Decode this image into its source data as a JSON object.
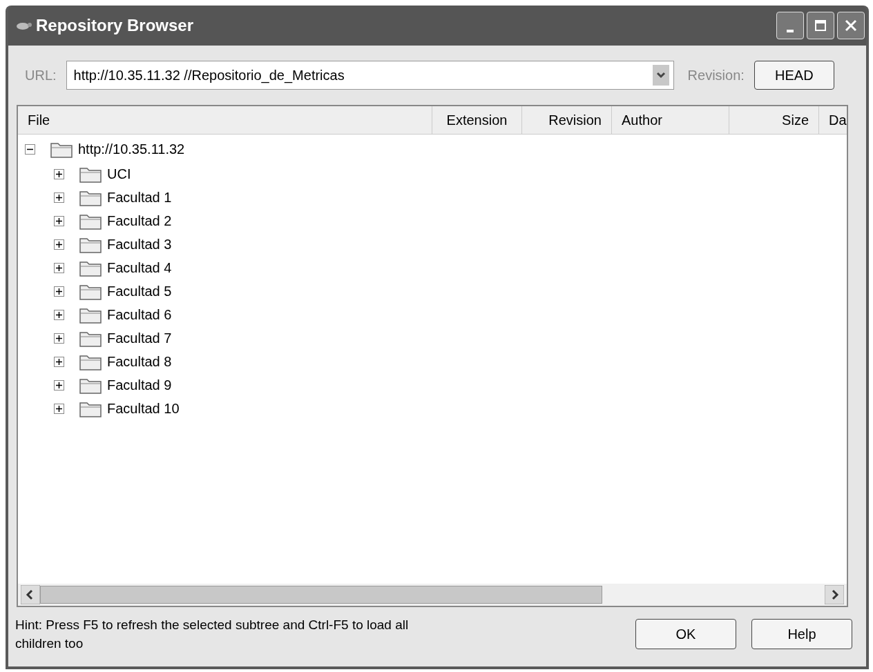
{
  "window": {
    "title": "Repository Browser"
  },
  "url": {
    "label": "URL:",
    "value": "http://10.35.11.32 //Repositorio_de_Metricas"
  },
  "revision": {
    "label": "Revision:",
    "button": "HEAD"
  },
  "table": {
    "columns": [
      "File",
      "Extension",
      "Revision",
      "Author",
      "Size",
      "Da"
    ],
    "tree": [
      {
        "label": "http://10.35.11.32",
        "expanded": true,
        "children": [
          {
            "label": "UCI",
            "expanded": false
          },
          {
            "label": "Facultad 1",
            "expanded": false
          },
          {
            "label": "Facultad 2",
            "expanded": false
          },
          {
            "label": "Facultad 3",
            "expanded": false
          },
          {
            "label": "Facultad 4",
            "expanded": false
          },
          {
            "label": "Facultad 5",
            "expanded": false
          },
          {
            "label": "Facultad 6",
            "expanded": false
          },
          {
            "label": "Facultad 7",
            "expanded": false
          },
          {
            "label": "Facultad 8",
            "expanded": false
          },
          {
            "label": "Facultad 9",
            "expanded": false
          },
          {
            "label": "Facultad 10",
            "expanded": false
          }
        ]
      }
    ]
  },
  "hint": "Hint: Press F5 to refresh the selected subtree and Ctrl-F5 to load all children too",
  "buttons": [
    "OK",
    "Help"
  ]
}
